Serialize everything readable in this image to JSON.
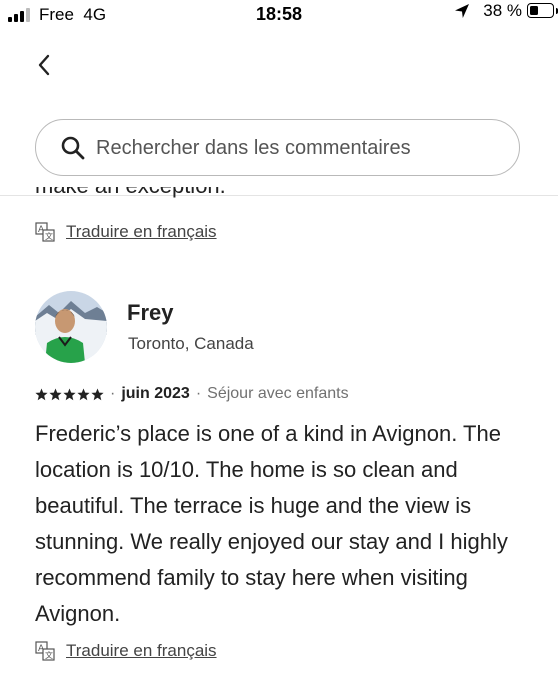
{
  "status_bar": {
    "carrier": "Free",
    "network": "4G",
    "time": "18:58",
    "battery_percent": "38 %",
    "battery_level": 0.38
  },
  "search": {
    "placeholder": "Rechercher dans les commentaires"
  },
  "previous_review": {
    "cut_text": "make an exception.",
    "translate_label": "Traduire en français"
  },
  "review": {
    "name": "Frey",
    "location": "Toronto, Canada",
    "rating": 5,
    "date": "juin 2023",
    "trip_type": "Séjour avec enfants",
    "text": "Frederic’s place is one of a kind in Avignon. The location is 10/10. The home is so clean and beautiful. The terrace is huge and the view is stunning. We really enjoyed our stay and I highly recommend family to stay here when visiting Avignon.",
    "translate_label": "Traduire en français"
  },
  "icons": {
    "back": "chevron-left-icon",
    "search": "search-icon",
    "translate": "translate-icon",
    "star": "star-icon",
    "location": "location-arrow-icon"
  },
  "colors": {
    "text_primary": "#222222",
    "text_secondary": "#717171",
    "border": "#b9b9b9"
  }
}
